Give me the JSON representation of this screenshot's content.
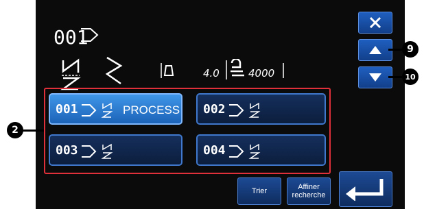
{
  "header": {
    "pattern_number": "001",
    "parameters": {
      "stitch_length": "4.0",
      "max_speed": "4000"
    }
  },
  "buttons": {
    "close_icon": "close-icon",
    "up_icon": "arrow-up-icon",
    "down_icon": "arrow-down-icon",
    "sort_label": "Trier",
    "refine_label_line1": "Affiner",
    "refine_label_line2": "recherche",
    "enter_icon": "enter-arrow-icon"
  },
  "callouts": {
    "up": "9",
    "down": "10",
    "list": "2"
  },
  "patterns": [
    {
      "number": "001",
      "label": "PROCESS",
      "selected": true
    },
    {
      "number": "002",
      "label": "",
      "selected": false
    },
    {
      "number": "003",
      "label": "",
      "selected": false
    },
    {
      "number": "004",
      "label": "",
      "selected": false
    }
  ],
  "colors": {
    "screen_bg": "#0b0b0b",
    "button_blue": "#1c4a94",
    "selected_blue": "#3f96e8",
    "frame_red": "#e0303a"
  }
}
